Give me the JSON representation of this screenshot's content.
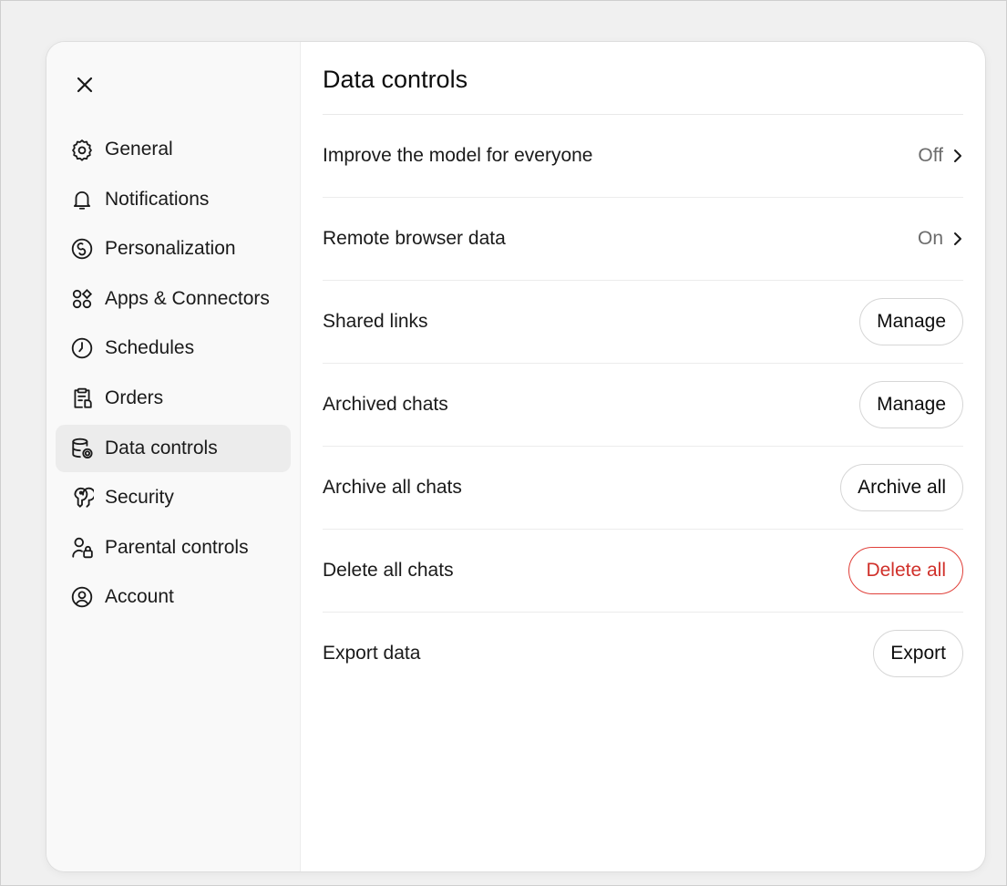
{
  "sidebar": {
    "items": [
      {
        "label": "General",
        "icon": "gear-icon"
      },
      {
        "label": "Notifications",
        "icon": "bell-icon"
      },
      {
        "label": "Personalization",
        "icon": "personalization-icon"
      },
      {
        "label": "Apps & Connectors",
        "icon": "apps-icon"
      },
      {
        "label": "Schedules",
        "icon": "clock-icon"
      },
      {
        "label": "Orders",
        "icon": "clipboard-icon"
      },
      {
        "label": "Data controls",
        "icon": "database-gear-icon"
      },
      {
        "label": "Security",
        "icon": "key-icon"
      },
      {
        "label": "Parental controls",
        "icon": "person-lock-icon"
      },
      {
        "label": "Account",
        "icon": "user-circle-icon"
      }
    ],
    "active_index": 6
  },
  "main": {
    "title": "Data controls",
    "rows": [
      {
        "label": "Improve the model for everyone",
        "value": "Off"
      },
      {
        "label": "Remote browser data",
        "value": "On"
      },
      {
        "label": "Shared links",
        "button": "Manage"
      },
      {
        "label": "Archived chats",
        "button": "Manage"
      },
      {
        "label": "Archive all chats",
        "button": "Archive all"
      },
      {
        "label": "Delete all chats",
        "button": "Delete all"
      },
      {
        "label": "Export data",
        "button": "Export"
      }
    ]
  },
  "colors": {
    "danger": "#d0302a",
    "active_bg": "#ececec",
    "sidebar_bg": "#f9f9f9"
  }
}
